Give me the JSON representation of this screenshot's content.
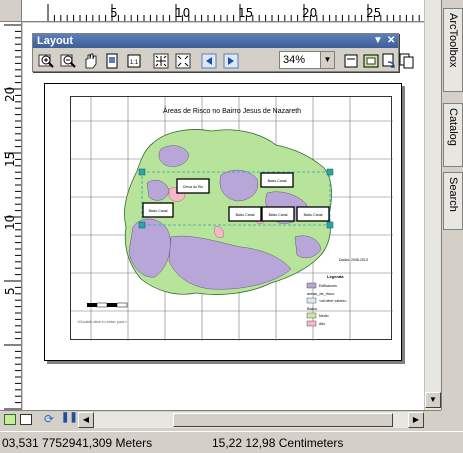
{
  "ruler": {
    "top_labels": [
      "5",
      "10",
      "15",
      "20",
      "25"
    ],
    "left_labels": [
      "20",
      "15",
      "10",
      "5"
    ]
  },
  "layout_toolbar": {
    "title": "Layout",
    "zoom_value": "34%",
    "buttons": [
      "zoom-in-icon",
      "zoom-out-icon",
      "pan-icon",
      "zoom-whole-page-icon",
      "zoom-100-icon",
      "fixed-zoom-in-icon",
      "fixed-zoom-out-icon",
      "back-extent-icon",
      "forward-extent-icon",
      "toggle-draft-mode-icon",
      "focus-data-frame-icon",
      "change-layout-icon",
      "data-driven-pages-icon"
    ]
  },
  "map": {
    "title": "Áreas de Risco no Bairro Jesus de Nazareth",
    "boxes": [
      "Cerca do Rio",
      "Baixo Canal",
      "Baixo Canal",
      "Baixo Canal",
      "Baixo Canal",
      "Baixo Canal"
    ],
    "legend_title": "Legenda",
    "legend_items": [
      "Edificacoes",
      "areas_de_risco",
      "Baixo",
      "Medio",
      "Alto"
    ],
    "legend_header": "<all other values>",
    "source_text": "Dados: 2008-2013",
    "hint": "<Double-click to enter your>"
  },
  "sidebar": {
    "tabs": [
      "ArcToolbox",
      "Catalog",
      "Search"
    ]
  },
  "status": {
    "map_coords": "03,531  7752941,309 Meters",
    "page_coords": "15,22  12,98 Centimeters"
  },
  "colors": {
    "title_bar": "#3d5f99",
    "map_fill": "#b8e39a",
    "buildings": "#b9a6d8",
    "risk": "#f6b7c9",
    "selection": "#2aa6a6"
  }
}
